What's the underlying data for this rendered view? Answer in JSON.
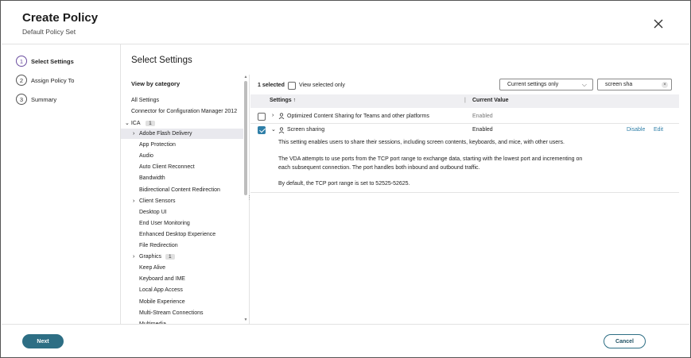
{
  "header": {
    "title": "Create Policy",
    "subtitle": "Default Policy Set"
  },
  "steps": [
    {
      "num": "1",
      "label": "Select Settings"
    },
    {
      "num": "2",
      "label": "Assign Policy To"
    },
    {
      "num": "3",
      "label": "Summary"
    }
  ],
  "main": {
    "title": "Select Settings"
  },
  "categories": {
    "heading": "View by category",
    "all": "All Settings",
    "connector": "Connector for Configuration Manager 2012",
    "ica": {
      "label": "ICA",
      "count": "1"
    },
    "items": [
      {
        "label": "Adobe Flash Delivery",
        "expand": true
      },
      {
        "label": "App Protection"
      },
      {
        "label": "Audio"
      },
      {
        "label": "Auto Client Reconnect"
      },
      {
        "label": "Bandwidth"
      },
      {
        "label": "Bidirectional Content Redirection"
      },
      {
        "label": "Client Sensors",
        "expand": true
      },
      {
        "label": "Desktop UI"
      },
      {
        "label": "End User Monitoring"
      },
      {
        "label": "Enhanced Desktop Experience"
      },
      {
        "label": "File Redirection"
      },
      {
        "label": "Graphics",
        "expand": true,
        "count": "1"
      },
      {
        "label": "Keep Alive"
      },
      {
        "label": "Keyboard and IME"
      },
      {
        "label": "Local App Access"
      },
      {
        "label": "Mobile Experience"
      },
      {
        "label": "Multi-Stream Connections"
      },
      {
        "label": "Multimedia"
      }
    ]
  },
  "toolbar": {
    "selected_count": "1 selected",
    "view_selected_label": "View selected only",
    "filter_value": "Current settings only",
    "search_value": "screen sha"
  },
  "table": {
    "col_settings": "Settings",
    "col_sort_icon": "↑",
    "col_value": "Current Value",
    "rows": [
      {
        "name": "Optimized Content Sharing for Teams and other platforms",
        "value": "Enabled",
        "checked": false
      },
      {
        "name": "Screen sharing",
        "value": "Enabled",
        "checked": true,
        "disable_label": "Disable",
        "edit_label": "Edit",
        "desc1": "This setting enables users to share their sessions, including screen contents, keyboards, and mice, with other users.",
        "desc2a": "The VDA attempts to use ports from the TCP port range to exchange data, starting with the lowest port and incrementing on",
        "desc2b": "each subsequent connection. The port handles both inbound and outbound traffic.",
        "desc3": "By default, the TCP port range is set to 52525-52625."
      }
    ]
  },
  "footer": {
    "next_label": "Next",
    "cancel_label": "Cancel"
  },
  "colors": {
    "primary": "#2d6e84",
    "accent_purple": "#6b4ea0",
    "link": "#2f7fa8"
  }
}
